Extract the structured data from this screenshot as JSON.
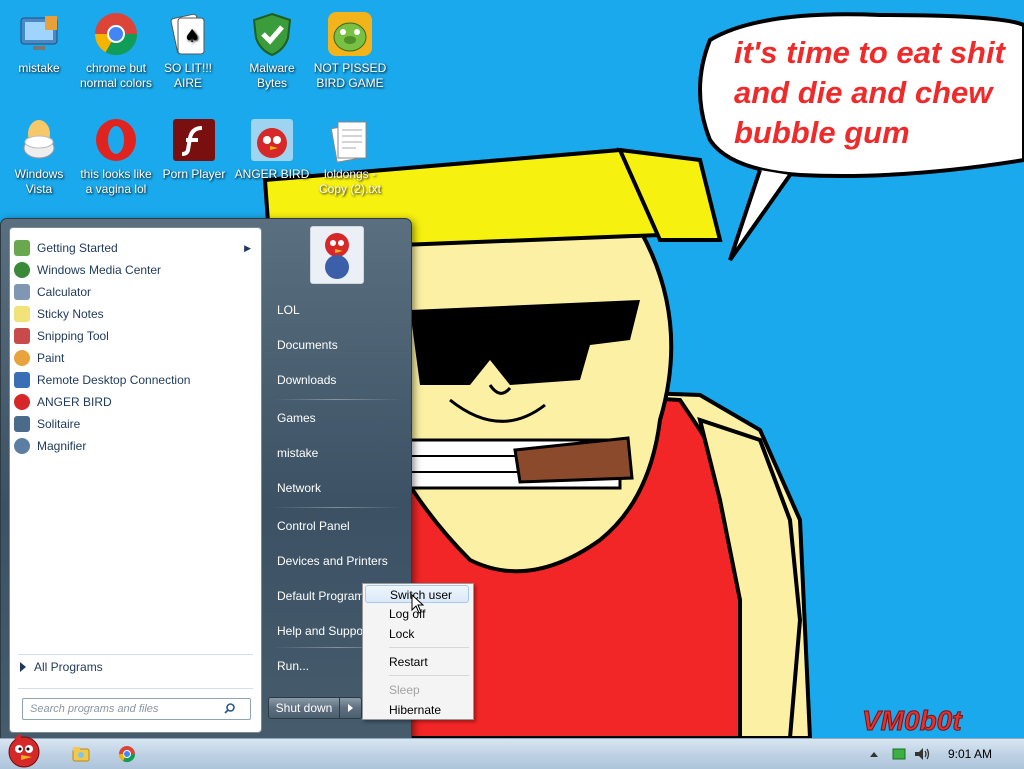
{
  "desktop": {
    "icons": [
      {
        "name": "desk-icon-mistake",
        "label": "mistake"
      },
      {
        "name": "desk-icon-chrome",
        "label": "chrome but normal colors"
      },
      {
        "name": "desk-icon-solitaire",
        "label": "SO LIT!!! AIRE"
      },
      {
        "name": "desk-icon-malwarebytes",
        "label": "Malware Bytes"
      },
      {
        "name": "desk-icon-pig-game",
        "label": "NOT PISSED BIRD GAME"
      },
      {
        "name": "desk-icon-windows-vista",
        "label": "Windows Vista"
      },
      {
        "name": "desk-icon-opera",
        "label": "this looks like a vagina lol"
      },
      {
        "name": "desk-icon-flash-player",
        "label": "Porn Player"
      },
      {
        "name": "desk-icon-anger-bird",
        "label": "ANGER BIRD"
      },
      {
        "name": "desk-icon-text-file",
        "label": "loldongs - Copy (2).txt"
      }
    ],
    "speech_bubble": [
      "it's time to eat shit",
      "and die and chew",
      "bubble gum"
    ],
    "signature": "VM0b0t"
  },
  "start_menu": {
    "programs": [
      {
        "label": "Getting Started",
        "icon": "getting-started-icon",
        "color": "#6aa84f",
        "submenu": true
      },
      {
        "label": "Windows Media Center",
        "icon": "media-center-icon",
        "color": "#3a8a3a"
      },
      {
        "label": "Calculator",
        "icon": "calculator-icon",
        "color": "#7f97b2"
      },
      {
        "label": "Sticky Notes",
        "icon": "sticky-notes-icon",
        "color": "#f1e27a"
      },
      {
        "label": "Snipping Tool",
        "icon": "snipping-tool-icon",
        "color": "#c94a4a"
      },
      {
        "label": "Paint",
        "icon": "paint-icon",
        "color": "#e8a33d"
      },
      {
        "label": "Remote Desktop Connection",
        "icon": "remote-desktop-icon",
        "color": "#3a6fb5"
      },
      {
        "label": "ANGER BIRD",
        "icon": "anger-bird-icon",
        "color": "#d62828"
      },
      {
        "label": "Solitaire",
        "icon": "solitaire-icon",
        "color": "#4a6b8a"
      },
      {
        "label": "Magnifier",
        "icon": "magnifier-icon",
        "color": "#5c7ea3"
      }
    ],
    "all_programs": "All Programs",
    "search_placeholder": "Search programs and files",
    "right_items": [
      "LOL",
      "Documents",
      "Downloads",
      "Games",
      "mistake",
      "Network",
      "Control Panel",
      "Devices and Printers",
      "Default Programs",
      "Help and Support",
      "Run..."
    ],
    "shutdown_label": "Shut down"
  },
  "context_menu": {
    "items": [
      {
        "label": "Switch user",
        "state": "hover"
      },
      {
        "label": "Log off",
        "state": "normal"
      },
      {
        "label": "Lock",
        "state": "normal"
      },
      {
        "label": "Restart",
        "state": "normal"
      },
      {
        "label": "Sleep",
        "state": "disabled"
      },
      {
        "label": "Hibernate",
        "state": "normal"
      }
    ]
  },
  "taskbar": {
    "clock": "9:01 AM"
  }
}
